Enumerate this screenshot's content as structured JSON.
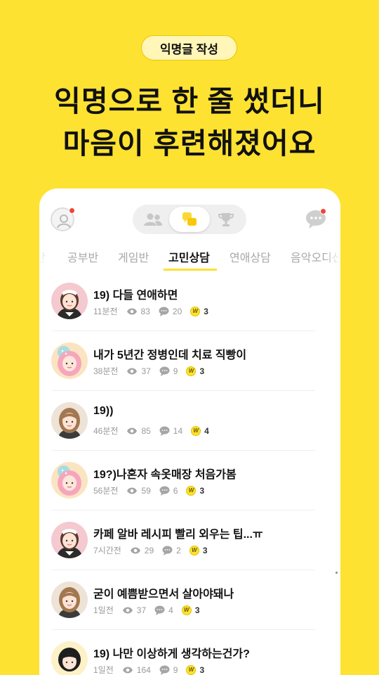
{
  "badge": "익명글 작성",
  "headline": {
    "line1": "익명으로 한 줄 썼더니",
    "line2": "마음이 후련해졌어요"
  },
  "colors": {
    "background": "#FDE232",
    "accent": "#FDE232",
    "notification": "#F0443A"
  },
  "header": {
    "profile_icon": "user-icon",
    "segment_icons": [
      "friends-icon",
      "chat-bubbles-icon",
      "trophy-icon"
    ],
    "message_icon": "chat-icon"
  },
  "tabs": [
    {
      "label": "반"
    },
    {
      "label": "공부반"
    },
    {
      "label": "게임반"
    },
    {
      "label": "고민상담",
      "active": true
    },
    {
      "label": "연애상담"
    },
    {
      "label": "음악오디션"
    }
  ],
  "posts": [
    {
      "title": "19) 다들 연애하면",
      "time": "11분전",
      "views": "83",
      "comments": "20",
      "coins": "3",
      "avatar": "maid-girl"
    },
    {
      "title": "내가 5년간 정병인데 치료 직빵이",
      "time": "38분전",
      "views": "37",
      "comments": "9",
      "coins": "3",
      "avatar": "pink-hair-girl"
    },
    {
      "title": "19))",
      "time": "46분전",
      "views": "85",
      "comments": "14",
      "coins": "4",
      "avatar": "brown-hair-girl"
    },
    {
      "title": "19?)나혼자 속옷매장 처음가봄",
      "time": "56분전",
      "views": "59",
      "comments": "6",
      "coins": "3",
      "avatar": "pink-hair-girl"
    },
    {
      "title": "카페 알바 레시피 빨리 외우는 팁...ㅠ",
      "time": "7시간전",
      "views": "29",
      "comments": "2",
      "coins": "3",
      "avatar": "maid-girl"
    },
    {
      "title": "굳이 예쁨받으면서 살아야돼나",
      "time": "1일전",
      "views": "37",
      "comments": "4",
      "coins": "3",
      "avatar": "brown-hair-girl"
    },
    {
      "title": "19) 나만 이상하게 생각하는건가?",
      "time": "1일전",
      "views": "164",
      "comments": "9",
      "coins": "3",
      "avatar": "black-hair-girl"
    }
  ]
}
